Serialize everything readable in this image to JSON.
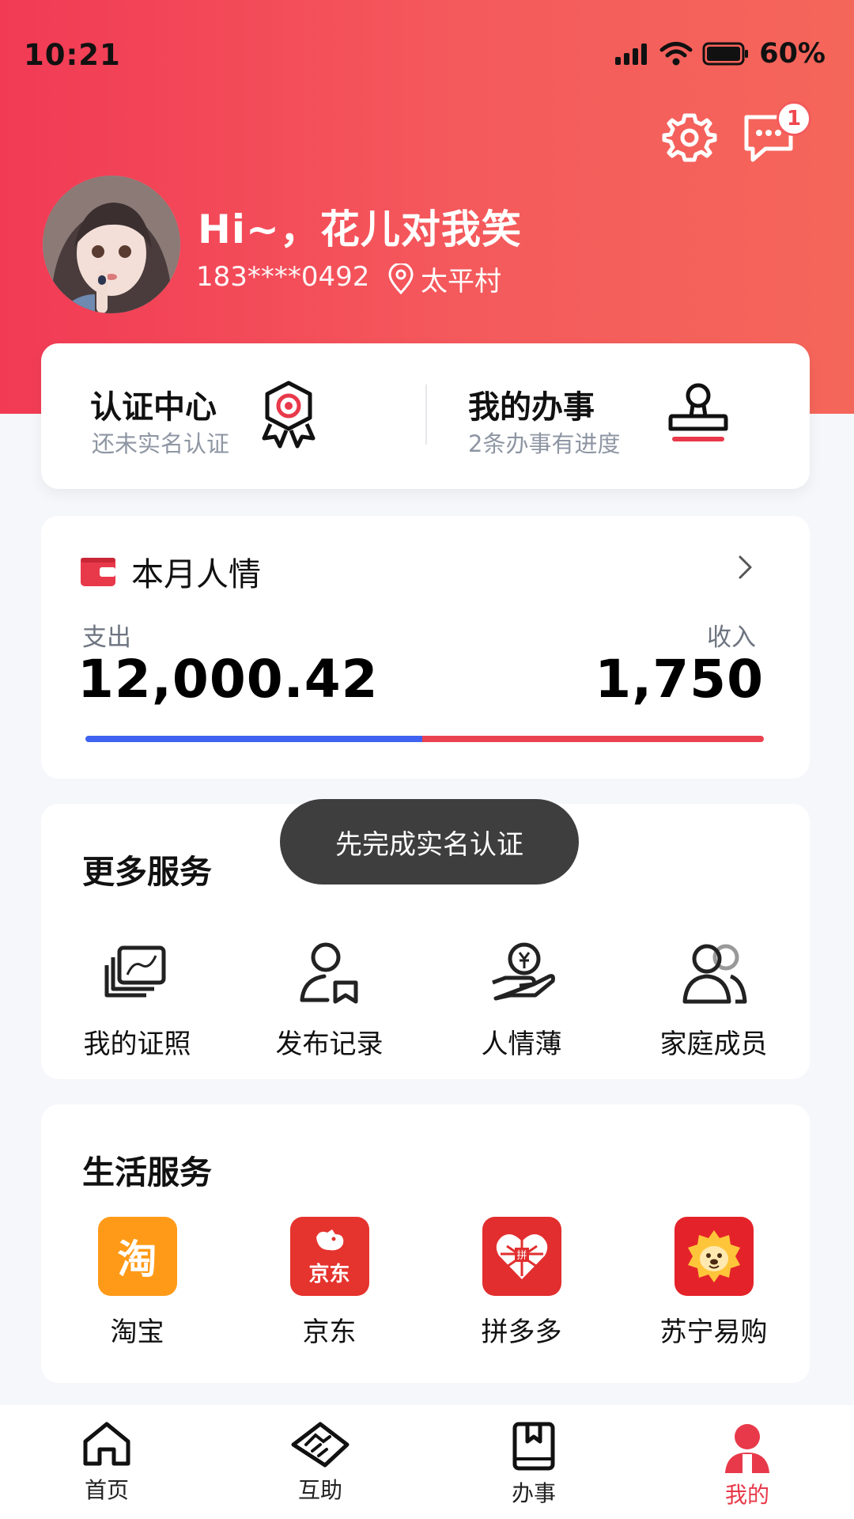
{
  "status_bar": {
    "time": "10:21",
    "battery": "60%"
  },
  "header": {
    "message_badge": "1",
    "greeting": "Hi~，花儿对我笑",
    "phone": "183****0492",
    "location": "太平村"
  },
  "quick_cards": [
    {
      "title": "认证中心",
      "subtitle": "还未实名认证",
      "icon": "badge-icon"
    },
    {
      "title": "我的办事",
      "subtitle": "2条办事有进度",
      "icon": "stamp-icon"
    }
  ],
  "monthly": {
    "title": "本月人情",
    "expense_label": "支出",
    "expense_value": "12,000.42",
    "income_label": "收入",
    "income_value": "1,750",
    "expense_ratio": 0.497,
    "expense_color": "#3f63f0",
    "income_color": "#ea4250"
  },
  "more_services": {
    "title": "更多服务",
    "items": [
      {
        "label": "我的证照",
        "icon": "certificate-icon"
      },
      {
        "label": "发布记录",
        "icon": "publish-record-icon"
      },
      {
        "label": "人情薄",
        "icon": "gift-ledger-icon"
      },
      {
        "label": "家庭成员",
        "icon": "family-icon"
      }
    ]
  },
  "toast": "先完成实名认证",
  "life_services": {
    "title": "生活服务",
    "items": [
      {
        "label": "淘宝",
        "icon_text": "淘",
        "color": "#ff9a18"
      },
      {
        "label": "京东",
        "icon_text": "京东",
        "color": "#e5332d"
      },
      {
        "label": "拼多多",
        "icon_text": "拼",
        "color": "#e22e2e"
      },
      {
        "label": "苏宁易购",
        "icon_text": "",
        "color": "#e4222a"
      }
    ]
  },
  "bottom_nav": [
    {
      "label": "首页",
      "icon": "home-icon"
    },
    {
      "label": "互助",
      "icon": "handshake-icon"
    },
    {
      "label": "办事",
      "icon": "book-icon"
    },
    {
      "label": "我的",
      "icon": "person-icon",
      "active": true
    }
  ],
  "theme": {
    "accent": "#e8394a",
    "header_gradient_start": "#f23a55",
    "header_gradient_end": "#f5665a"
  }
}
